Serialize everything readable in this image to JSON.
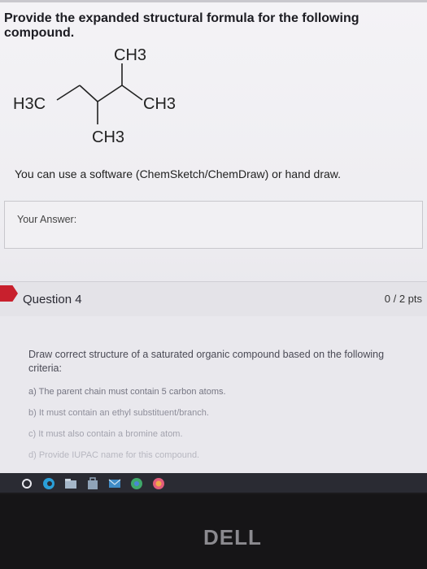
{
  "question": {
    "text": "Provide the expanded structural formula for the following compound.",
    "molecule_labels": {
      "top": "CH3",
      "left": "H3C",
      "right": "CH3",
      "bottom": "CH3"
    },
    "hint": "You can use a software (ChemSketch/ChemDraw) or hand draw.",
    "answer_label": "Your Answer:"
  },
  "question4": {
    "title": "Question 4",
    "points": "0 / 2 pts",
    "instructions": "Draw correct structure of a saturated organic compound based on the following criteria:",
    "criteria": [
      "a) The parent chain must contain 5 carbon atoms.",
      "b) It must contain an ethyl substituent/branch.",
      "c) It must also contain a bromine atom.",
      "d) Provide IUPAC name for this compound."
    ]
  },
  "taskbar": {
    "icons": [
      "start-icon",
      "edge-browser-icon",
      "file-explorer-icon",
      "store-icon",
      "mail-icon",
      "chrome-icon",
      "app-icon"
    ]
  },
  "device": {
    "brand": "DELL"
  },
  "colors": {
    "accent_flag": "#c8202d",
    "taskbar": "#2a2b33"
  }
}
